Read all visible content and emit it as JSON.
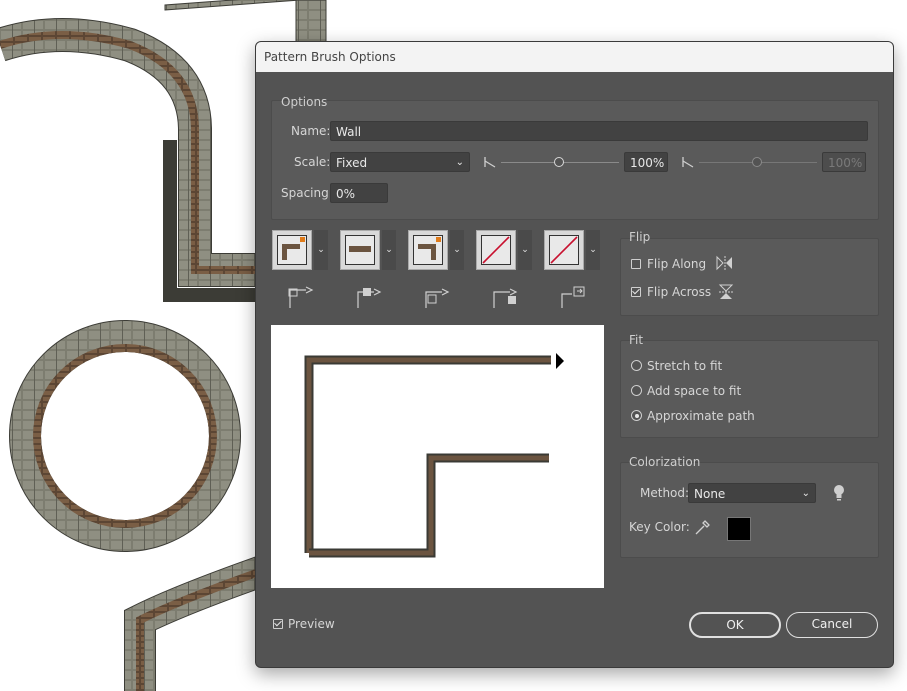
{
  "dialog": {
    "title": "Pattern Brush Options",
    "options": {
      "section_title": "Options",
      "name_label": "Name:",
      "name_value": "Wall",
      "scale_label": "Scale:",
      "scale_mode": "Fixed",
      "scale_value": "100%",
      "scale_value_disabled": "100%",
      "spacing_label": "Spacing:",
      "spacing_value": "0%"
    },
    "flip": {
      "section_title": "Flip",
      "flip_along_label": "Flip Along",
      "flip_along_checked": false,
      "flip_across_label": "Flip Across",
      "flip_across_checked": true
    },
    "fit": {
      "section_title": "Fit",
      "options": [
        "Stretch to fit",
        "Add space to fit",
        "Approximate path"
      ],
      "selected": "Approximate path"
    },
    "colorization": {
      "section_title": "Colorization",
      "method_label": "Method:",
      "method_value": "None",
      "key_color_label": "Key Color:",
      "key_color": "#000000"
    },
    "preview_label": "Preview",
    "preview_checked": true,
    "ok_label": "OK",
    "cancel_label": "Cancel"
  },
  "colors": {
    "dialog_bg": "#535353",
    "brick_brown": "#6b5440",
    "stone_gray": "#8a8a7e",
    "flip_red": "#c8102e"
  }
}
